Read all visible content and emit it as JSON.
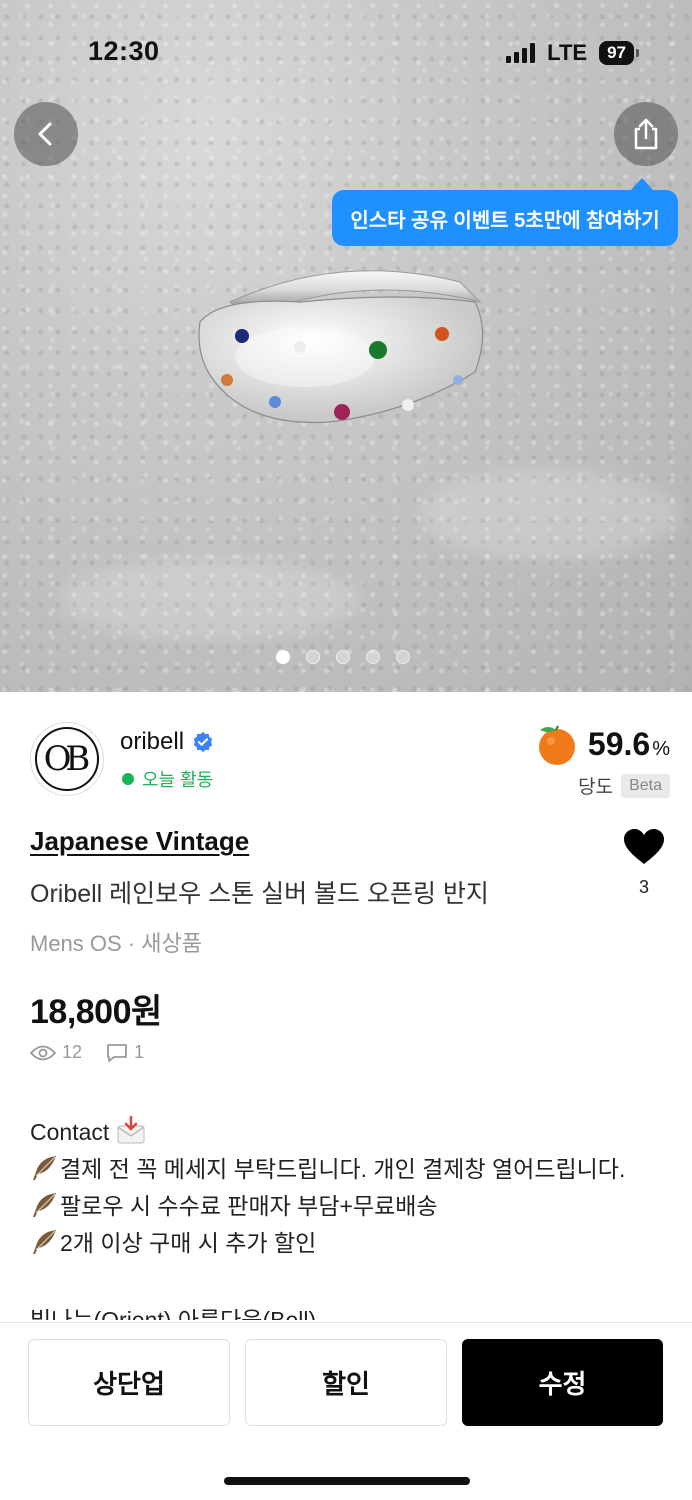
{
  "status": {
    "time": "12:30",
    "network": "LTE",
    "battery": "97"
  },
  "hero": {
    "tooltip": "인스타 공유 이벤트 5초만에 참여하기",
    "page_count": 5,
    "active_page": 1
  },
  "seller": {
    "name": "oribell",
    "logo_text": "OB",
    "activity": "오늘 활동",
    "activity_color": "#1bb35a"
  },
  "sweetness": {
    "value": "59.6",
    "unit": "%",
    "label": "당도",
    "badge": "Beta"
  },
  "product": {
    "brand": "Japanese Vintage",
    "title": "Oribell 레인보우 스톤 실버 볼드 오픈링 반지",
    "meta": "Mens OS · 새상품",
    "price": "18,800원",
    "views": "12",
    "comments": "1",
    "likes": "3"
  },
  "description": {
    "heading": "Contact",
    "lines": [
      "결제 전 꼭 메세지 부탁드립니다. 개인 결제창 열어드립니다.",
      "팔로우 시 수수료 판매자 부담+무료배송",
      "2개 이상 구매 시 추가 할인"
    ],
    "cut_line": "빛나는(Orient) 아름다움(Bell)"
  },
  "actions": {
    "bump": "상단업",
    "discount": "할인",
    "edit": "수정"
  },
  "colors": {
    "accent_blue": "#1e90ff",
    "verified": "#3b82f6",
    "orange": "#f07a1a"
  }
}
